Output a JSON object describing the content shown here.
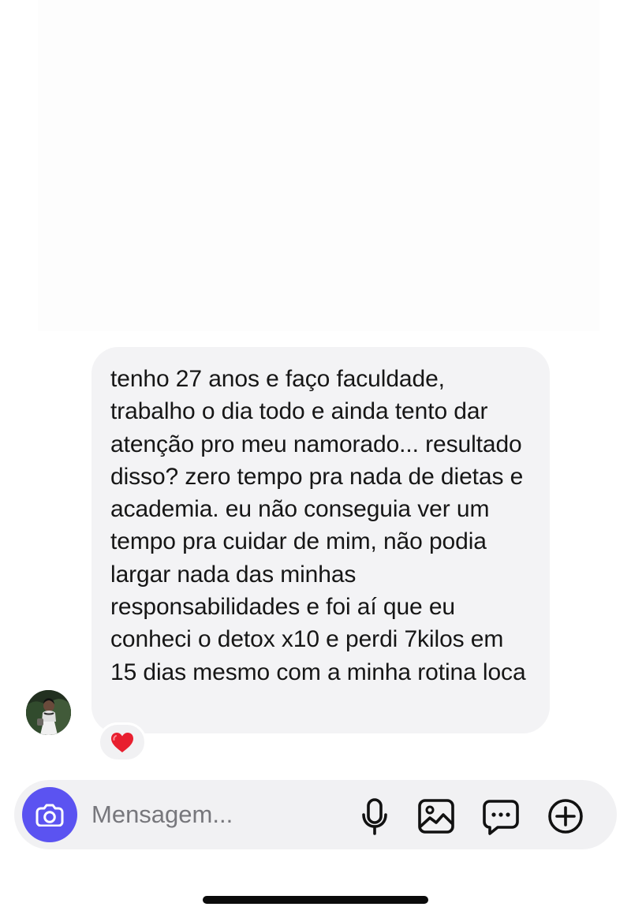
{
  "conversation": {
    "message_text": "tenho 27 anos e faço faculdade, trabalho o dia todo e ainda tento dar atenção pro meu namorado... resultado disso? zero tempo pra nada de dietas e academia. eu não conseguia ver um tempo pra cuidar de mim, não podia largar nada das minhas responsabilidades e foi aí que eu conheci o detox x10 e perdi 7kilos em 15 dias mesmo com a minha rotina loca",
    "reaction_icon": "heart-icon",
    "avatar_icon": "profile-photo"
  },
  "composer": {
    "placeholder": "Mensagem...",
    "camera_icon": "camera-icon",
    "actions": [
      "microphone-icon",
      "image-gallery-icon",
      "sticker-chat-icon",
      "plus-circle-icon"
    ]
  },
  "colors": {
    "accent": "#5b53f1",
    "bubble": "#f3f3f5",
    "composer": "#f1f1f3",
    "text": "#161616",
    "heart": "#e81f2f"
  }
}
